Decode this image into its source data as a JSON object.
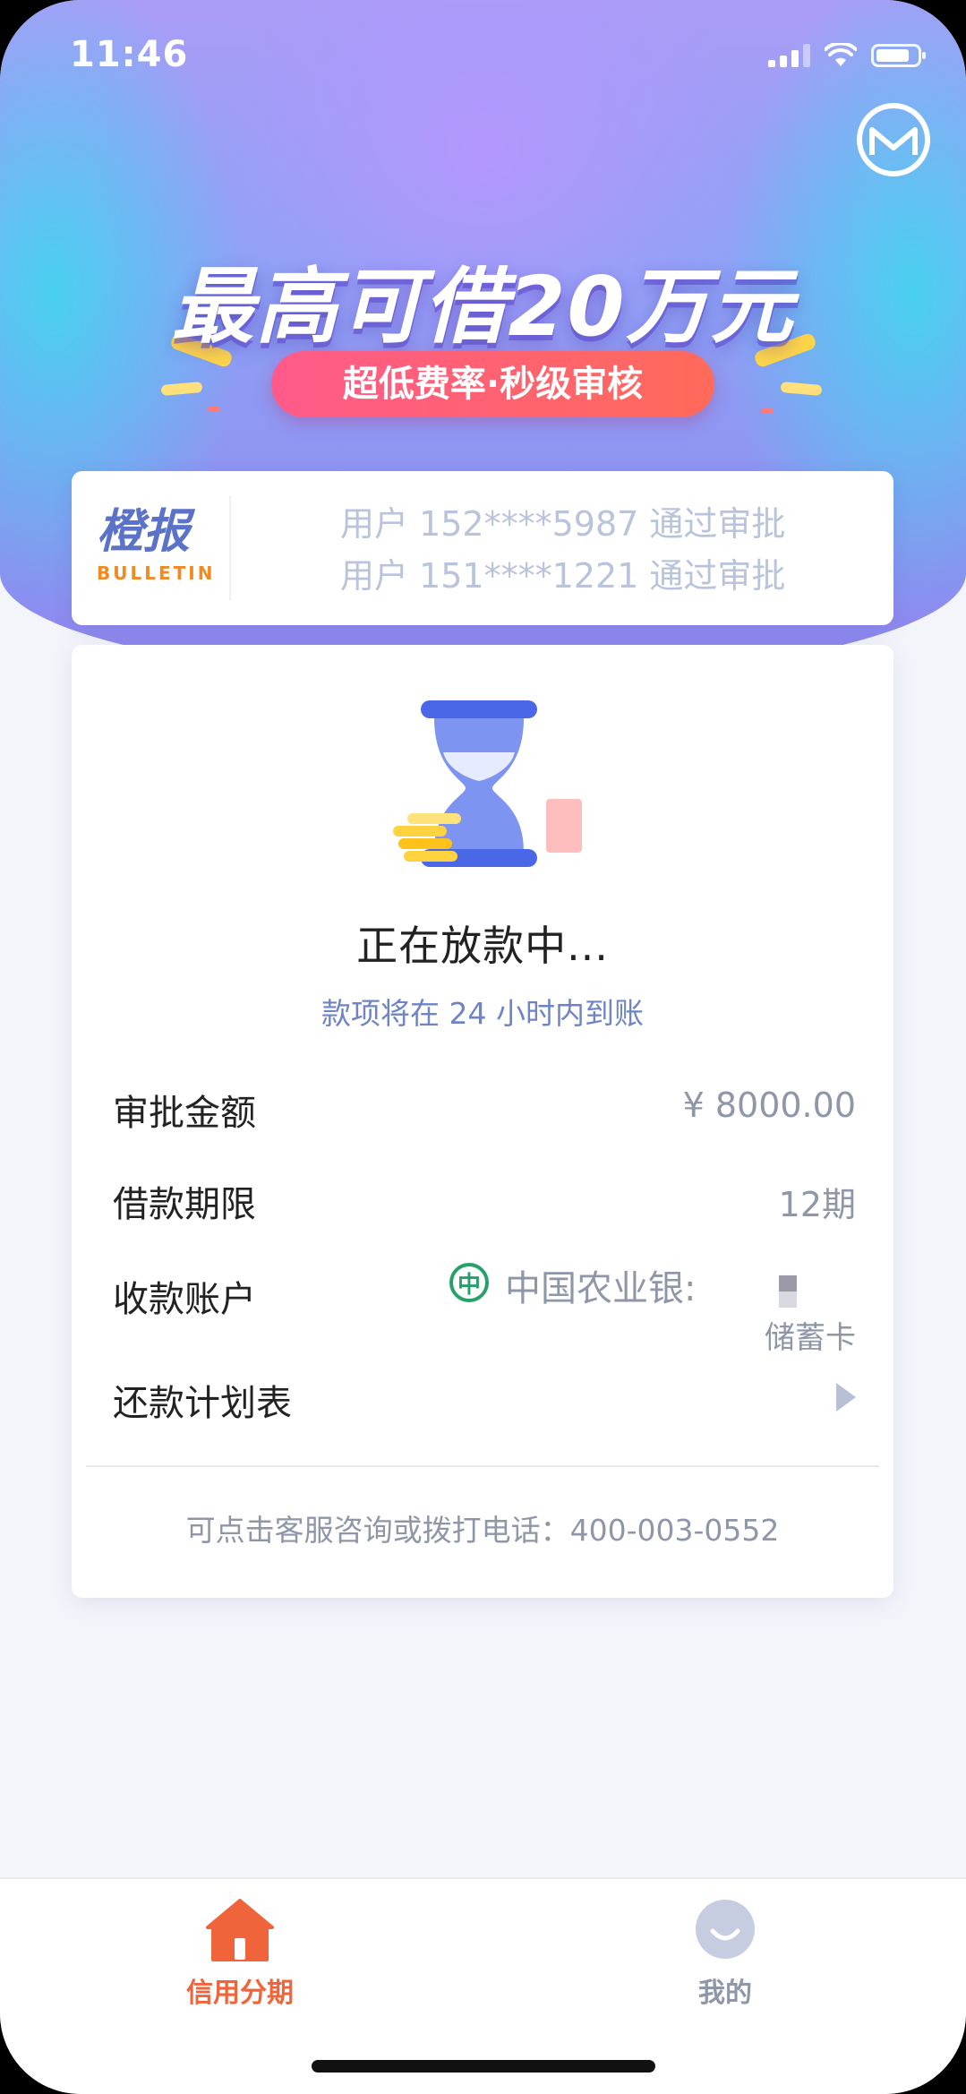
{
  "status_bar": {
    "time": "11:46"
  },
  "hero": {
    "headline": "最高可借20万元",
    "pill": "超低费率·秒级审核"
  },
  "bulletin": {
    "logo_cn": "橙报",
    "logo_en": "BULLETIN",
    "lines": [
      "用户 152****5987 通过审批",
      "用户 151****1221 通过审批"
    ]
  },
  "status": {
    "title": "正在放款中...",
    "subtitle": "款项将在 24 小时内到账"
  },
  "details": {
    "amount_label": "审批金额",
    "amount_value": "¥ 8000.00",
    "term_label": "借款期限",
    "term_value": "12期",
    "account_label": "收款账户",
    "bank_name": "中国农业银:",
    "card_type": "储蓄卡",
    "schedule_label": "还款计划表"
  },
  "contact": "可点击客服咨询或拨打电话：400-003-0552",
  "tabbar": {
    "tabs": [
      {
        "label": "信用分期",
        "active": true,
        "color": "#f0643c"
      },
      {
        "label": "我的",
        "active": false,
        "color": "#8e96a8"
      }
    ]
  },
  "colors": {
    "accent": "#f0643c",
    "link": "#6e84c4",
    "bank_green": "#27a06a"
  }
}
